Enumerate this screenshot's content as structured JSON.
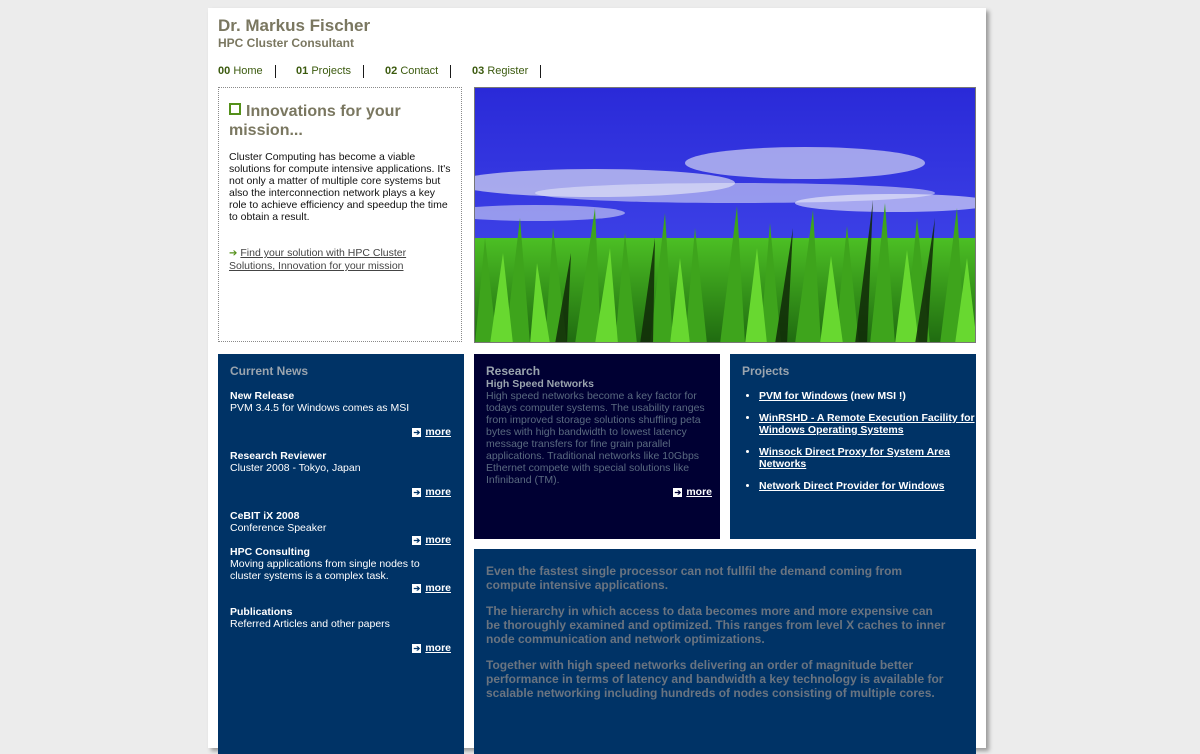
{
  "header": {
    "name": "Dr. Markus Fischer",
    "role": "HPC Cluster Consultant"
  },
  "nav": [
    {
      "num": "00",
      "label": "Home"
    },
    {
      "num": "01",
      "label": "Projects"
    },
    {
      "num": "02",
      "label": "Contact"
    },
    {
      "num": "03",
      "label": "Register"
    }
  ],
  "intro": {
    "title": "Innovations for your mission...",
    "body": "Cluster Computing has become a viable solutions for compute intensive applications. It's not only a matter of multiple core systems but also the interconnection network plays a key role to achieve efficiency and speedup the time to obtain a result.",
    "link": "Find your solution with HPC Cluster Solutions, Innovation for your mission"
  },
  "news": {
    "heading": "Current News",
    "items": [
      {
        "title": "New Release",
        "text": "PVM 3.4.5 for Windows comes as MSI",
        "more": "more"
      },
      {
        "title": "Research Reviewer",
        "text": "Cluster 2008 - Tokyo, Japan",
        "more": "more"
      },
      {
        "title": "CeBIT iX 2008",
        "text": "Conference Speaker",
        "more": "more"
      },
      {
        "title": "HPC Consulting",
        "text": "Moving applications from single nodes to cluster systems is a complex task.",
        "more": "more"
      },
      {
        "title": "Publications",
        "text": "Referred Articles and other papers",
        "more": "more"
      }
    ]
  },
  "research": {
    "heading": "Research",
    "subheading": "High Speed Networks",
    "body": "High speed networks become a key factor for todays computer systems. The usability ranges from improved storage solutions shuffling peta bytes with high bandwidth to lowest latency message transfers for fine grain parallel applications. Traditional networks like 10Gbps Ethernet compete with special solutions like Infiniband (TM).",
    "more": "more"
  },
  "projects": {
    "heading": "Projects",
    "items": [
      {
        "link": "PVM for Windows",
        "suffix": " (new MSI !)"
      },
      {
        "link": "WinRSHD - A Remote Execution Facility for Windows Operating Systems",
        "suffix": ""
      },
      {
        "link": "Winsock Direct Proxy for System Area Networks",
        "suffix": ""
      },
      {
        "link": "Network Direct Provider for Windows",
        "suffix": ""
      }
    ]
  },
  "text_panel": {
    "paragraphs": [
      "Even the fastest single processor can not fullfil the demand coming from compute intensive applications.",
      "The hierarchy in which access to data becomes more and more expensive can be thoroughly examined and optimized. This ranges from level X caches to inner node communication and network optimizations.",
      "Together with high speed networks delivering an order of magnitude better performance in terms of latency and bandwidth a key technology is available for scalable networking including hundreds of nodes consisting of multiple cores."
    ]
  },
  "colors": {
    "page_bg": "#ececec",
    "panel_blue": "#003366",
    "panel_dark": "#000033",
    "accent_green": "#54901a",
    "header_text": "#7a7760"
  },
  "icons": [
    "green-square-icon",
    "arrow-right-icon",
    "more-arrow-icon"
  ]
}
